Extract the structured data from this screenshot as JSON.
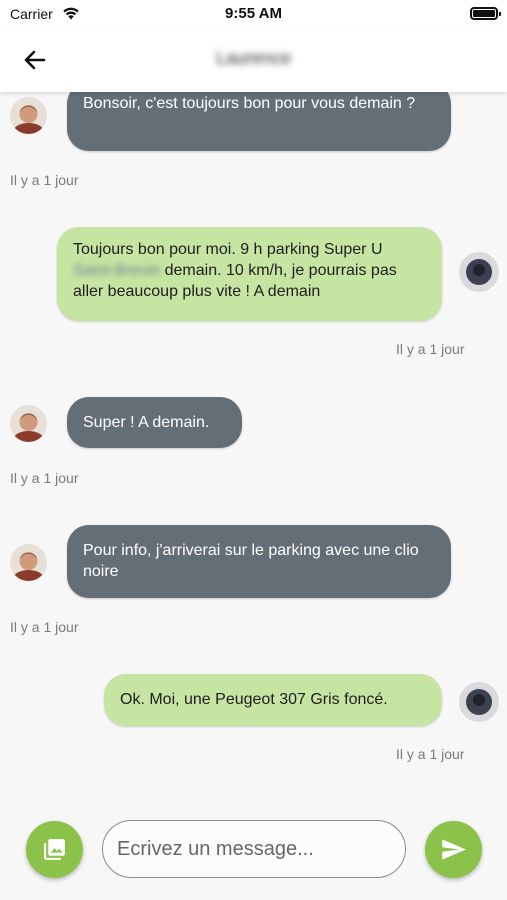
{
  "status_bar": {
    "carrier": "Carrier",
    "time": "9:55 AM"
  },
  "header": {
    "title": "Laurence"
  },
  "messages": [
    {
      "direction": "incoming",
      "text": "Bonsoir, c'est toujours bon pour vous demain ?",
      "timestamp": "Il y a 1 jour"
    },
    {
      "direction": "outgoing",
      "text_part1": "Toujours bon pour moi. 9 h parking Super U",
      "text_hidden": "Saint-Brevin",
      "text_part2": "demain. 10 km/h, je pourrais pas aller beaucoup plus vite ! A demain",
      "timestamp": "Il y a 1 jour"
    },
    {
      "direction": "incoming",
      "text": "Super ! A demain.",
      "timestamp": "Il y a 1 jour"
    },
    {
      "direction": "incoming",
      "text": "Pour info, j'arriverai sur le parking avec une clio noire",
      "timestamp": "Il y a 1 jour"
    },
    {
      "direction": "outgoing",
      "text": "Ok. Moi, une Peugeot 307 Gris foncé.",
      "timestamp": "Il y a 1 jour"
    }
  ],
  "composer": {
    "placeholder": "Ecrivez un message..."
  },
  "colors": {
    "incoming_bubble": "#646e77",
    "outgoing_bubble": "#c6e5a2",
    "accent": "#8bc34a"
  },
  "icons": {
    "back": "arrow-left-icon",
    "image": "photo-library-icon",
    "send": "send-icon"
  }
}
